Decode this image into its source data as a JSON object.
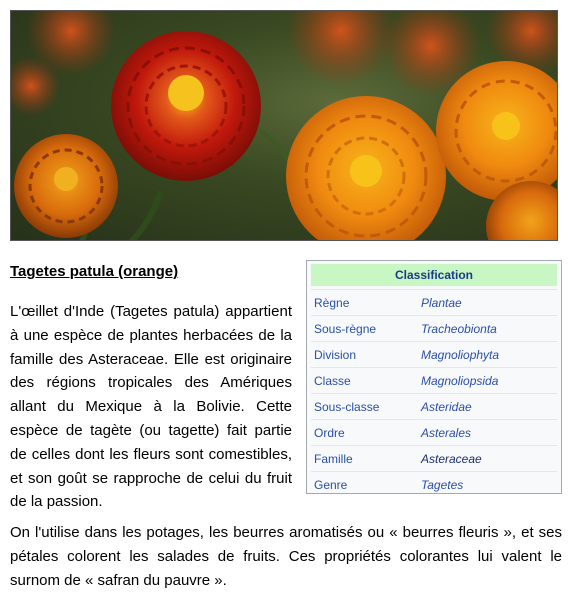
{
  "article": {
    "title": "Tagetes patula (orange)",
    "paragraph1": "L'œillet d'Inde (Tagetes patula) appartient à une espèce de plantes herbacées de la famille des Asteraceae. Elle est originaire des régions tropicales des Amériques allant du Mexique à la Bolivie. Cette espèce de tagète (ou tagette) fait partie de celles dont les fleurs sont comestibles, et son goût se rapproche de celui du fruit de la passion.",
    "paragraph2": "On l'utilise dans les potages, les beurres aromatisés ou « beurres fleuris », et ses pétales colorent les salades de fruits. Ces propriétés colorantes lui valent le surnom de « safran du pauvre »."
  },
  "classification": {
    "title": "Classification",
    "rows": [
      {
        "label": "Règne",
        "value": "Plantae"
      },
      {
        "label": "Sous-règne",
        "value": "Tracheobionta"
      },
      {
        "label": "Division",
        "value": "Magnoliophyta"
      },
      {
        "label": "Classe",
        "value": "Magnoliopsida"
      },
      {
        "label": "Sous-classe",
        "value": "Asteridae"
      },
      {
        "label": "Ordre",
        "value": "Asterales"
      },
      {
        "label": "Famille",
        "value": "Asteraceae"
      },
      {
        "label": "Genre",
        "value": "Tagetes"
      }
    ]
  },
  "colors": {
    "link": "#2a4fa8",
    "infobox_header": "#c8f7c3",
    "flower_red": "#c0180c",
    "flower_orange": "#f08a10"
  }
}
